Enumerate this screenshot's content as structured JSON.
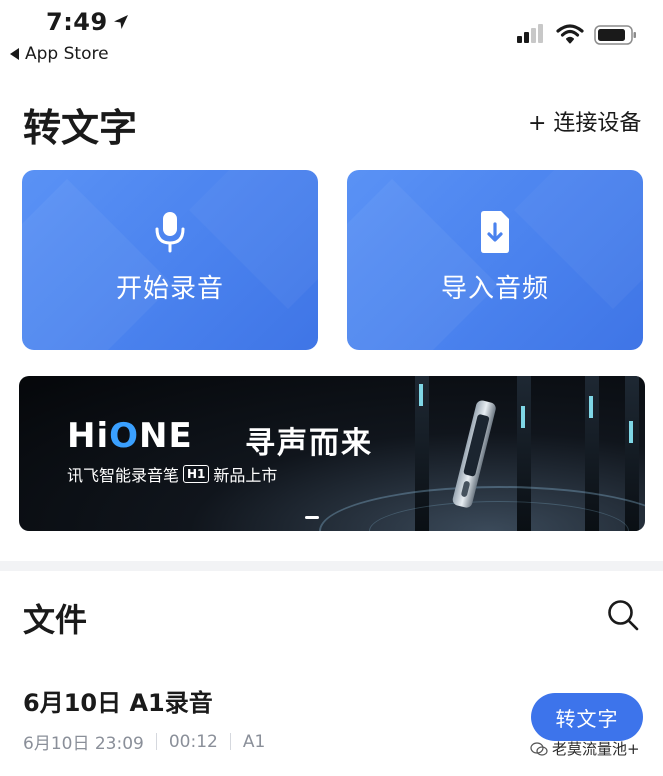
{
  "status_bar": {
    "time": "7:49",
    "back_label": "App Store",
    "icons": [
      "location-arrow-icon",
      "cellular-signal-icon",
      "wifi-icon",
      "battery-icon"
    ]
  },
  "header": {
    "title": "转文字",
    "connect_label": "+ 连接设备"
  },
  "actions": {
    "record": {
      "label": "开始录音",
      "icon": "microphone-icon"
    },
    "import": {
      "label": "导入音频",
      "icon": "file-download-icon"
    }
  },
  "banner": {
    "brand": "HiONE",
    "brand_hi": "Hi",
    "brand_o": "O",
    "brand_ne": "NE",
    "tagline": "寻声而来",
    "sub_prefix": "讯飞智能录音笔",
    "badge": "H1",
    "sub_suffix": "新品上市"
  },
  "files": {
    "title": "文件",
    "items": [
      {
        "name": "6月10日 A1录音",
        "date": "6月10日 23:09",
        "duration": "00:12",
        "device": "A1",
        "action_label": "转文字"
      }
    ]
  },
  "watermark": "老莫流量池+",
  "colors": {
    "accent": "#3d74eb",
    "card_blue": "#4a82ee",
    "meta_gray": "#8a8f99"
  }
}
